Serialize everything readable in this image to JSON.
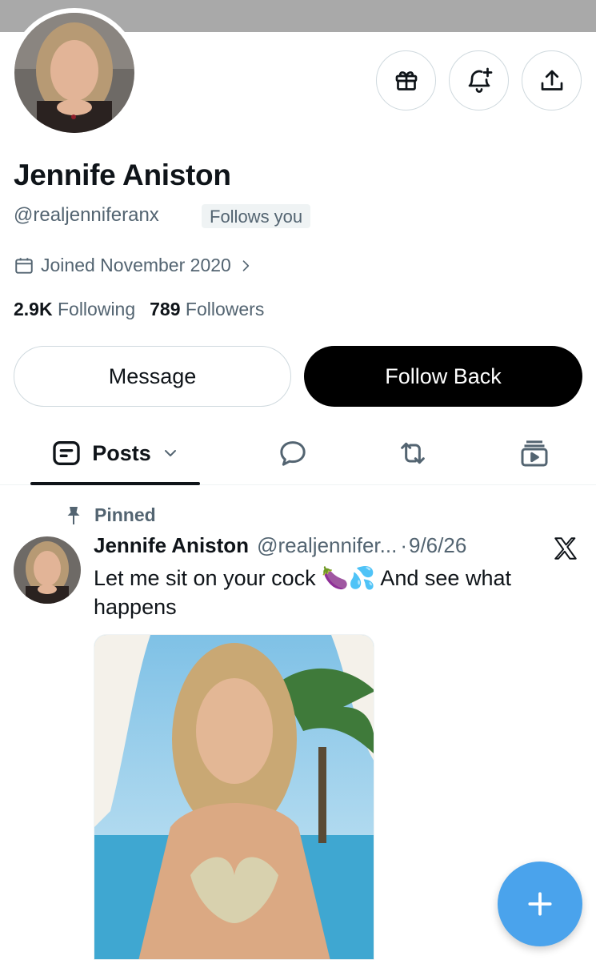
{
  "profile": {
    "display_name": "Jennife Aniston",
    "handle": "@realjenniferanx",
    "follows_you": "Follows you",
    "joined": "Joined November 2020",
    "following_count": "2.9K",
    "following_label": "Following",
    "followers_count": "789",
    "followers_label": "Followers"
  },
  "actions": {
    "message": "Message",
    "follow_back": "Follow Back"
  },
  "tabs": {
    "posts": "Posts"
  },
  "post": {
    "pinned_label": "Pinned",
    "author_name": "Jennife Aniston",
    "author_handle": "@realjennifer...",
    "separator": "·",
    "date": "9/6/26",
    "text": "Let me sit on your cock 🍆💦 And see what happens"
  },
  "colors": {
    "banner": "#a9a9a9",
    "fab": "#4aa3ec",
    "muted_text": "#536471"
  },
  "icons": {
    "gift": "gift-icon",
    "notify": "bell-plus-icon",
    "share": "share-icon",
    "calendar": "calendar-icon",
    "chevron": "chevron-right-icon",
    "posts": "posts-icon",
    "replies": "reply-bubble-icon",
    "reposts": "repost-icon",
    "media": "media-icon",
    "pin": "pin-icon",
    "x": "x-logo-icon",
    "compose": "plus-icon"
  }
}
